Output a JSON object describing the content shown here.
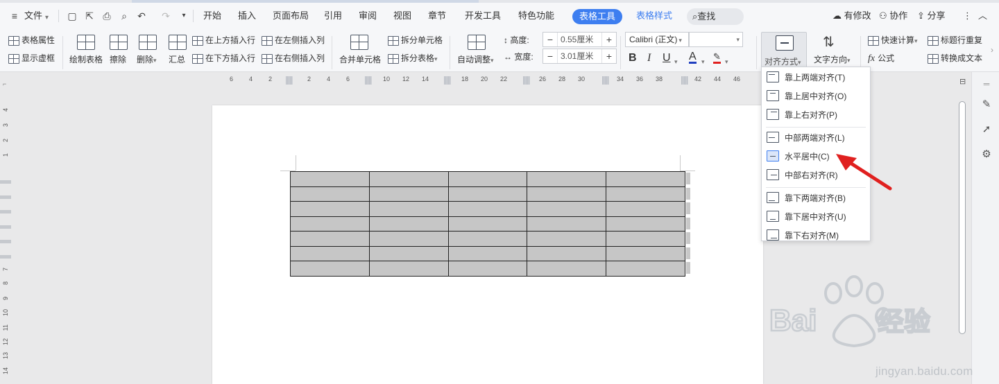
{
  "menubar": {
    "file": "文件",
    "tabs": [
      "开始",
      "插入",
      "页面布局",
      "引用",
      "审阅",
      "视图",
      "章节",
      "开发工具",
      "特色功能"
    ],
    "active_tab": "表格工具",
    "table_style_tab": "表格样式",
    "search": "查找",
    "right": {
      "modified": "有修改",
      "collab": "协作",
      "share": "分享"
    }
  },
  "ribbon": {
    "table_props": "表格属性",
    "show_gridlines": "显示虚框",
    "draw_table": "绘制表格",
    "erase": "擦除",
    "delete": "删除",
    "summary": "汇总",
    "insert_row_above": "在上方插入行",
    "insert_row_below": "在下方插入行",
    "insert_col_left": "在左侧插入列",
    "insert_col_right": "在右侧插入列",
    "merge_cells": "合并单元格",
    "split_cells": "拆分单元格",
    "split_table": "拆分表格",
    "auto_fit": "自动调整",
    "height_label": "高度:",
    "height_value": "0.55厘米",
    "width_label": "宽度:",
    "width_value": "3.01厘米",
    "font_name": "Calibri (正文)",
    "font_size": "",
    "bold": "B",
    "italic": "I",
    "underline": "U",
    "font_color": "A",
    "align_mode": "对齐方式",
    "text_direction": "文字方向",
    "quick_calc": "快速计算",
    "repeat_header": "标题行重复",
    "formula": "公式",
    "to_text": "转换成文本"
  },
  "ruler": {
    "h_ticks": [
      "6",
      "4",
      "2",
      "2",
      "4",
      "6",
      "10",
      "12",
      "14",
      "18",
      "20",
      "22",
      "26",
      "28",
      "30",
      "34",
      "36",
      "38",
      "42",
      "44",
      "46"
    ],
    "v_ticks": [
      "4",
      "3",
      "2",
      "1",
      "7",
      "8",
      "9",
      "10",
      "11",
      "12",
      "13",
      "14"
    ]
  },
  "dropdown": {
    "items": [
      {
        "label": "靠上两端对齐(T)",
        "group": 0
      },
      {
        "label": "靠上居中对齐(O)",
        "group": 0
      },
      {
        "label": "靠上右对齐(P)",
        "group": 0
      },
      {
        "label": "中部两端对齐(L)",
        "group": 1
      },
      {
        "label": "水平居中(C)",
        "group": 1,
        "selected": true
      },
      {
        "label": "中部右对齐(R)",
        "group": 1
      },
      {
        "label": "靠下两端对齐(B)",
        "group": 2
      },
      {
        "label": "靠下居中对齐(U)",
        "group": 2
      },
      {
        "label": "靠下右对齐(M)",
        "group": 2
      }
    ]
  },
  "table": {
    "rows": 7,
    "cols": 5
  },
  "watermark": {
    "url": "jingyan.baidu.com"
  },
  "colors": {
    "accent": "#3d7ef0",
    "arrow": "#e0201f",
    "table_fill": "#c6c6c6"
  }
}
